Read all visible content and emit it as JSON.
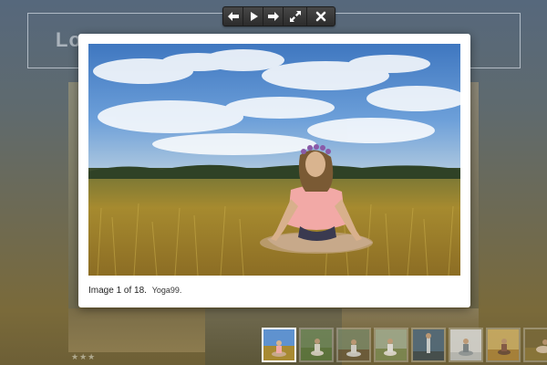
{
  "background_page": {
    "logo_text": "Lo",
    "rating_stars": "★★★"
  },
  "toolbar": {
    "buttons": [
      {
        "icon": "arrow-left-icon",
        "action": "previous"
      },
      {
        "icon": "play-icon",
        "action": "slideshow"
      },
      {
        "icon": "arrow-right-icon",
        "action": "next"
      },
      {
        "icon": "fullscreen-icon",
        "action": "fullscreen"
      },
      {
        "icon": "close-icon",
        "action": "close"
      }
    ]
  },
  "lightbox": {
    "caption_counter": "Image 1 of 18.",
    "caption_title": "Yoga99.",
    "image_subject": "woman meditating in lotus pose in a grass field under blue sky"
  },
  "thumbnails": {
    "active_index": 0,
    "items": [
      "yoga-thumb-1",
      "yoga-thumb-2",
      "yoga-thumb-3",
      "yoga-thumb-4",
      "yoga-thumb-5",
      "yoga-thumb-6",
      "yoga-thumb-7",
      "yoga-thumb-8"
    ]
  },
  "colors": {
    "toolbar_bg": "#333333",
    "sky": "#4f86c8",
    "grass": "#a88a32"
  }
}
